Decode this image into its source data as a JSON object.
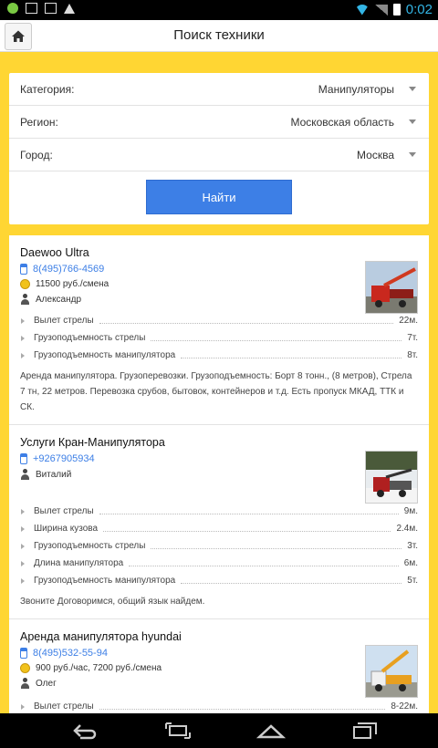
{
  "status_bar": {
    "time": "0:02"
  },
  "header": {
    "title": "Поиск техники"
  },
  "filters": [
    {
      "label": "Категория:",
      "value": "Манипуляторы"
    },
    {
      "label": "Регион:",
      "value": "Московская область"
    },
    {
      "label": "Город:",
      "value": "Москва"
    }
  ],
  "search_button": "Найти",
  "listings": [
    {
      "name": "Daewoo Ultra",
      "phone": "8(495)766-4569",
      "price": "11500 руб./смена",
      "contact": "Александр",
      "specs": [
        {
          "label": "Вылет стрелы",
          "value": "22м."
        },
        {
          "label": "Грузоподъемность стрелы",
          "value": "7т."
        },
        {
          "label": "Грузоподъемность манипулятора",
          "value": "8т."
        }
      ],
      "description": "Аренда манипулятора. Грузоперевозки. Грузоподъемность: Борт 8 тонн., (8 метров), Стрела 7 тн, 22 метров. Перевозка срубов, бытовок, контейнеров и т.д. Есть пропуск МКАД, ТТК и СК."
    },
    {
      "name": "Услуги Кран-Манипулятора",
      "phone": "+9267905934",
      "contact": "Виталий",
      "specs": [
        {
          "label": "Вылет стрелы",
          "value": "9м."
        },
        {
          "label": "Ширина кузова",
          "value": "2.4м."
        },
        {
          "label": "Грузоподъемность стрелы",
          "value": "3т."
        },
        {
          "label": "Длина манипулятора",
          "value": "6м."
        },
        {
          "label": "Грузоподъемность манипулятора",
          "value": "5т."
        }
      ],
      "description": "Звоните Договоримся, общий язык найдем."
    },
    {
      "name": "Аренда манипулятора hyundai",
      "phone": "8(495)532-55-94",
      "price": "900 руб./час, 7200 руб./смена",
      "contact": "Олег",
      "specs": [
        {
          "label": "Вылет стрелы",
          "value": "8-22м."
        }
      ]
    }
  ],
  "icons": {
    "home": "home-icon",
    "phone": "phone-icon",
    "price": "coin-icon",
    "contact": "person-icon",
    "back": "back-icon",
    "recent": "recent-apps-icon",
    "navhome": "nav-home-icon",
    "screenshot": "screenshot-icon"
  },
  "colors": {
    "accent": "#ffd633",
    "button": "#3d7fe6",
    "link": "#3d7fe6"
  }
}
